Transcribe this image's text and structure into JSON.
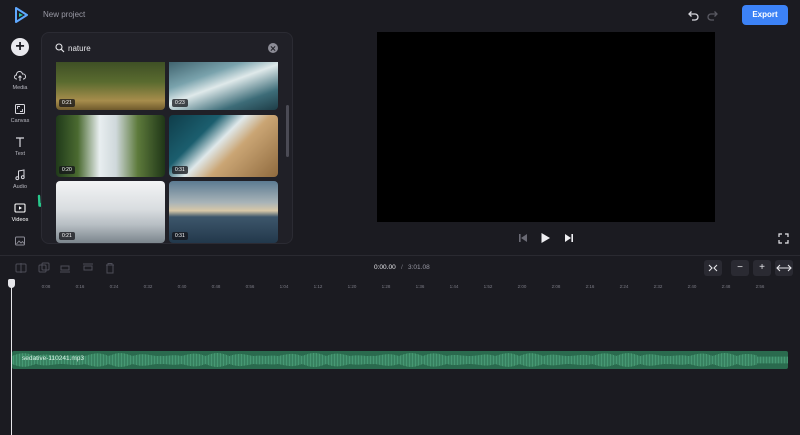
{
  "app": {
    "project_title": "New project",
    "export_label": "Export"
  },
  "rail": {
    "items": [
      {
        "label": "Media"
      },
      {
        "label": "Canvas"
      },
      {
        "label": "Text"
      },
      {
        "label": "Audio"
      },
      {
        "label": "Videos"
      }
    ]
  },
  "search": {
    "value": "nature"
  },
  "thumbs": [
    {
      "duration": "0:21"
    },
    {
      "duration": "0:23"
    },
    {
      "duration": "0:20"
    },
    {
      "duration": "0:31"
    },
    {
      "duration": "0:21"
    },
    {
      "duration": "0:31"
    }
  ],
  "timeline": {
    "current_time": "0:00.00",
    "separator": "/",
    "total_time": "3:01.08",
    "ticks": [
      "0",
      "0:08",
      "0:16",
      "0:24",
      "0:32",
      "0:40",
      "0:48",
      "0:56",
      "1:04",
      "1:12",
      "1:20",
      "1:28",
      "1:36",
      "1:44",
      "1:52",
      "2:00",
      "2:08",
      "2:16",
      "2:24",
      "2:32",
      "2:40",
      "2:48",
      "2:56"
    ],
    "zoom_out_label": "−",
    "zoom_in_label": "+",
    "audio_clip": "sedative-110241.mp3"
  },
  "colors": {
    "accent": "#3c82f6",
    "audio": "#2a6a4e",
    "arrow": "#28c88c"
  }
}
